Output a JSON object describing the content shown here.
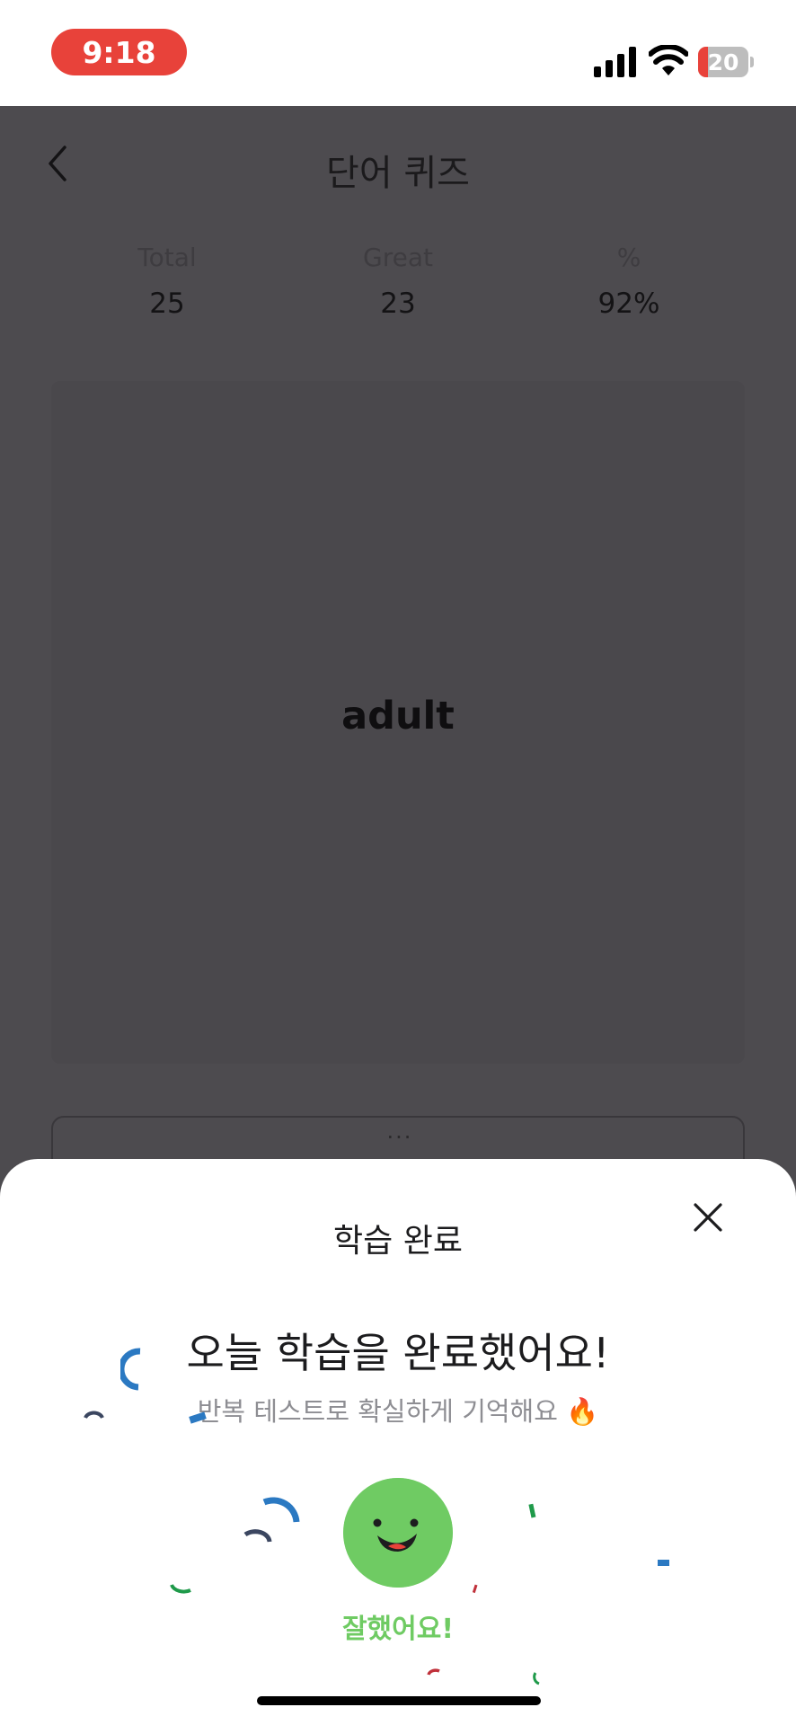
{
  "status_bar": {
    "time": "9:18",
    "battery_level": "20",
    "battery_fraction": 0.2,
    "time_pill_color": "#e8423a"
  },
  "quiz": {
    "title": "단어 퀴즈",
    "stats": [
      {
        "label": "Total",
        "value": "25"
      },
      {
        "label": "Great",
        "value": "23"
      },
      {
        "label": "%",
        "value": "92%"
      }
    ],
    "word": "adult",
    "answer_placeholder": "···"
  },
  "completion_sheet": {
    "title": "학습 완료",
    "headline": "오늘 학습을 완료했어요!",
    "subtitle": "반복 테스트로 확실하게 기억해요 🔥",
    "praise": "잘했어요!",
    "accent_color": "#6fcb63"
  },
  "icons": {
    "back": "chevron-left-icon",
    "close": "close-icon",
    "signal": "cellular-signal-icon",
    "wifi": "wifi-icon",
    "battery": "battery-icon",
    "mascot": "smiling-face-icon"
  }
}
